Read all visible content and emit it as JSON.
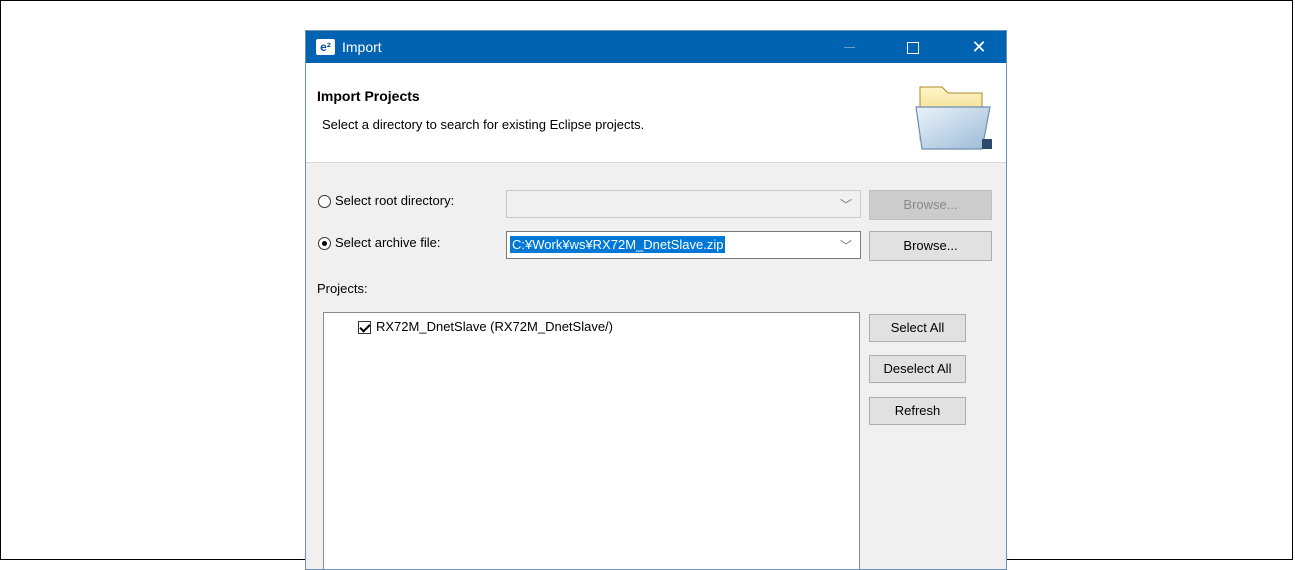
{
  "window": {
    "app_icon": "e²",
    "title": "Import",
    "controls": {
      "minimize_icon": "minimize-icon",
      "maximize_icon": "maximize-icon",
      "close_icon": "close-icon"
    }
  },
  "header": {
    "title": "Import Projects",
    "description": "Select a directory to search for existing Eclipse projects.",
    "icon": "folder-icon"
  },
  "source": {
    "root_directory": {
      "label": "Select root directory:",
      "selected": false,
      "value": "",
      "browse_label": "Browse...",
      "enabled": false
    },
    "archive_file": {
      "label": "Select archive file:",
      "selected": true,
      "value": "C:¥Work¥ws¥RX72M_DnetSlave.zip",
      "browse_label": "Browse...",
      "enabled": true
    }
  },
  "projects": {
    "label": "Projects:",
    "items": [
      {
        "label": "RX72M_DnetSlave (RX72M_DnetSlave/)",
        "checked": true
      }
    ],
    "buttons": {
      "select_all": "Select All",
      "deselect_all": "Deselect All",
      "refresh": "Refresh"
    }
  },
  "colors": {
    "titlebar": "#0063b1",
    "selection": "#0078d7"
  }
}
